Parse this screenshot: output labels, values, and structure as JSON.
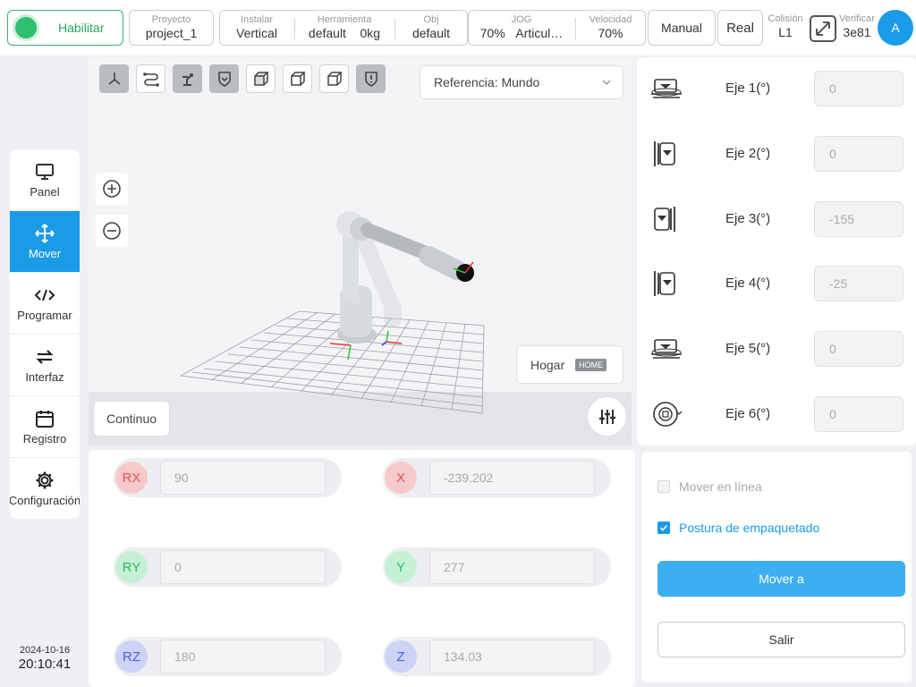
{
  "topbar": {
    "enable_label": "Habilitar",
    "project": {
      "key": "Proyecto",
      "value": "project_1"
    },
    "install": {
      "key": "Instalar",
      "value": "Vertical"
    },
    "tool": {
      "key": "Herramienta",
      "value": "default",
      "value2": "0kg"
    },
    "obj": {
      "key": "Obj",
      "value": "default"
    },
    "jog": {
      "key": "JOG",
      "value": "70%",
      "value2": "Articul…"
    },
    "speed": {
      "key": "Velocidad",
      "value": "70%"
    },
    "manual_label": "Manual",
    "real_label": "Real",
    "collision": {
      "key": "Colisión",
      "value": "L1"
    },
    "verify": {
      "key": "Verificar",
      "value": "3e81"
    },
    "avatar_letter": "A",
    "accent_color": "#1a9be8",
    "enable_color": "#2fbf71"
  },
  "sidebar": {
    "items": [
      {
        "label": "Panel",
        "icon": "monitor-icon",
        "active": false
      },
      {
        "label": "Mover",
        "icon": "move-arrows-icon",
        "active": true
      },
      {
        "label": "Programar",
        "icon": "code-icon",
        "active": false
      },
      {
        "label": "Interfaz",
        "icon": "swap-icon",
        "active": false
      },
      {
        "label": "Registro",
        "icon": "calendar-icon",
        "active": false
      },
      {
        "label": "Configuración",
        "icon": "gear-icon",
        "active": false
      }
    ],
    "date": "2024-10-16",
    "time": "20:10:41"
  },
  "viewport": {
    "reference_select": "Referencia: Mundo",
    "home_label": "Hogar",
    "home_badge": "HOME",
    "continuous_label": "Continuo"
  },
  "joints": [
    {
      "label": "Eje 1(°)",
      "value": "0"
    },
    {
      "label": "Eje 2(°)",
      "value": "0"
    },
    {
      "label": "Eje 3(°)",
      "value": "-155"
    },
    {
      "label": "Eje 4(°)",
      "value": "-25"
    },
    {
      "label": "Eje 5(°)",
      "value": "0"
    },
    {
      "label": "Eje 6(°)",
      "value": "0"
    }
  ],
  "pose": {
    "rx": {
      "label": "RX",
      "value": "90"
    },
    "ry": {
      "label": "RY",
      "value": "0"
    },
    "rz": {
      "label": "RZ",
      "value": "180"
    },
    "x": {
      "label": "X",
      "value": "-239.202"
    },
    "y": {
      "label": "Y",
      "value": "277"
    },
    "z": {
      "label": "Z",
      "value": "134.03"
    }
  },
  "moveto": {
    "linear_label": "Mover en línea",
    "linear_checked": false,
    "packing_label": "Postura de empaquetado",
    "packing_checked": true,
    "move_label": "Mover a",
    "exit_label": "Salir"
  }
}
